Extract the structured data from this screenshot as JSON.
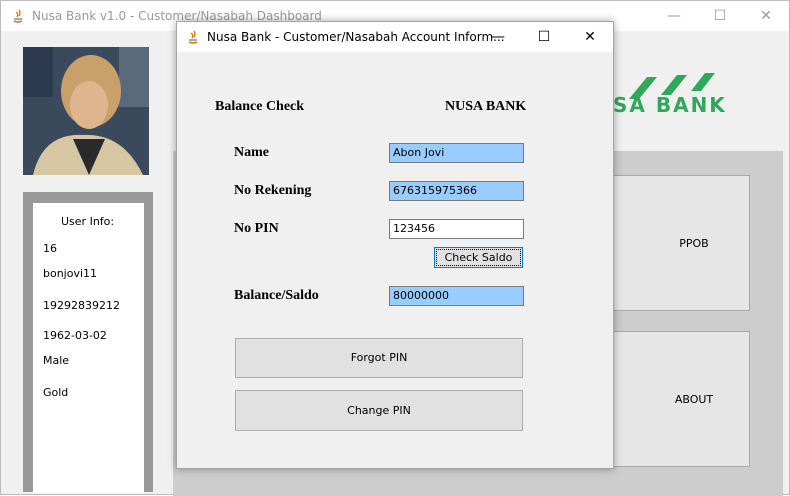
{
  "main_window": {
    "title": "Nusa Bank v1.0 -  Customer/Nasabah Dashboard",
    "controls": {
      "minimize": "—",
      "maximize": "☐",
      "close": "✕"
    }
  },
  "user_info": {
    "header": "User Info:",
    "id": "16",
    "username": "bonjovi11",
    "phone": "19292839212",
    "birthdate": "1962-03-02",
    "gender": "Male",
    "tier": "Gold"
  },
  "logo": {
    "text": "SA BANK",
    "color": "#2fa85b"
  },
  "menu": {
    "ppob": "PPOB",
    "about": "ABOUT"
  },
  "dialog": {
    "title": "Nusa Bank - Customer/Nasabah Account Inform...",
    "controls": {
      "minimize": "—",
      "maximize": "☐",
      "close": "✕"
    },
    "heading": "Balance Check",
    "bank_name": "NUSA BANK",
    "name_label": "Name",
    "name_value": "Abon Jovi",
    "rekening_label": "No Rekening",
    "rekening_value": "676315975366",
    "pin_label": "No PIN",
    "pin_value": "123456",
    "check_button": "Check Saldo",
    "balance_label": "Balance/Saldo",
    "balance_value": "80000000",
    "forgot_pin_button": "Forgot PIN",
    "change_pin_button": "Change PIN"
  },
  "colors": {
    "readonly_field": "#99ccff",
    "brand_green": "#2fa85b"
  }
}
